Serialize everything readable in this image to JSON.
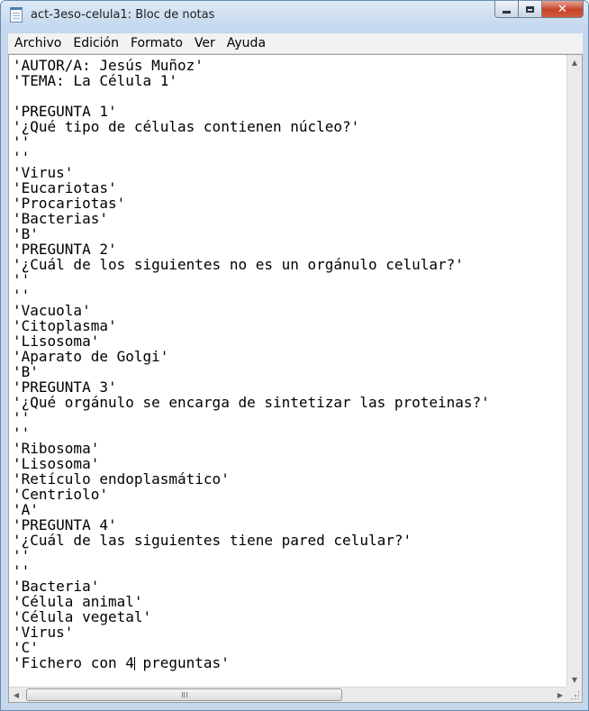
{
  "window": {
    "title": "act-3eso-celula1: Bloc de notas",
    "controls": {
      "minimize_icon": "minimize-icon",
      "maximize_icon": "maximize-icon",
      "close_icon": "close-icon",
      "close_glyph": "✕"
    }
  },
  "menu": {
    "items": [
      {
        "label": "Archivo"
      },
      {
        "label": "Edición"
      },
      {
        "label": "Formato"
      },
      {
        "label": "Ver"
      },
      {
        "label": "Ayuda"
      }
    ]
  },
  "document": {
    "lines": [
      "'AUTOR/A: Jesús Muñoz'",
      "'TEMA: La Célula 1'",
      "",
      "'PREGUNTA 1'",
      "'¿Qué tipo de células contienen núcleo?'",
      "''",
      "''",
      "'Virus'",
      "'Eucariotas'",
      "'Procariotas'",
      "'Bacterias'",
      "'B'",
      "'PREGUNTA 2'",
      "'¿Cuál de los siguientes no es un orgánulo celular?'",
      "''",
      "''",
      "'Vacuola'",
      "'Citoplasma'",
      "'Lisosoma'",
      "'Aparato de Golgi'",
      "'B'",
      "'PREGUNTA 3'",
      "'¿Qué orgánulo se encarga de sintetizar las proteinas?'",
      "''",
      "''",
      "'Ribosoma'",
      "'Lisosoma'",
      "'Retículo endoplasmático'",
      "'Centriolo'",
      "'A'",
      "'PREGUNTA 4'",
      "'¿Cuál de las siguientes tiene pared celular?'",
      "''",
      "''",
      "'Bacteria'",
      "'Célula animal'",
      "'Célula vegetal'",
      "'Virus'",
      "'C'"
    ],
    "last_line_before_caret": "'Fichero con 4",
    "last_line_after_caret": " preguntas'"
  },
  "scrollbars": {
    "up_arrow": "▲",
    "down_arrow": "▼",
    "left_arrow": "◀",
    "right_arrow": "▶"
  }
}
